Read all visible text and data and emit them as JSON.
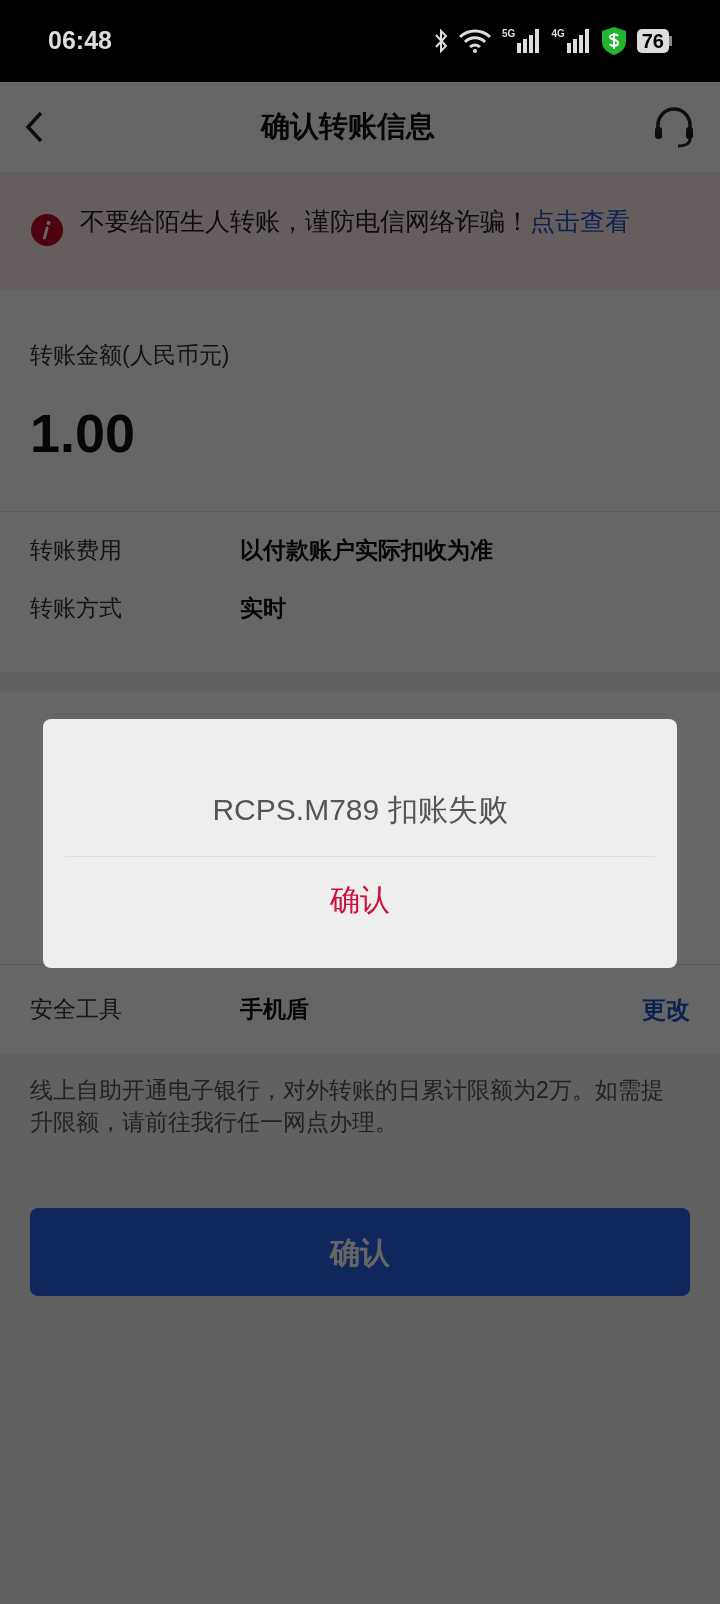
{
  "status_bar": {
    "time": "06:48",
    "battery": "76",
    "network_5g": "5G",
    "network_4g": "4G"
  },
  "header": {
    "title": "确认转账信息"
  },
  "warning": {
    "text": "不要给陌生人转账，谨防电信网络诈骗！",
    "link": "点击查看"
  },
  "amount": {
    "label": "转账金额(人民币元)",
    "value": "1.00"
  },
  "details": [
    {
      "label": "转账费用",
      "value": "以付款账户实际扣收为准"
    },
    {
      "label": "转账方式",
      "value": "实时"
    }
  ],
  "security": {
    "label": "安全工具",
    "value": "手机盾",
    "action": "更改"
  },
  "note": "线上自助开通电子银行，对外转账的日累计限额为2万。如需提升限额，请前往我行任一网点办理。",
  "confirm_button": "确认",
  "dialog": {
    "message": "RCPS.M789 扣账失败",
    "button": "确认"
  }
}
